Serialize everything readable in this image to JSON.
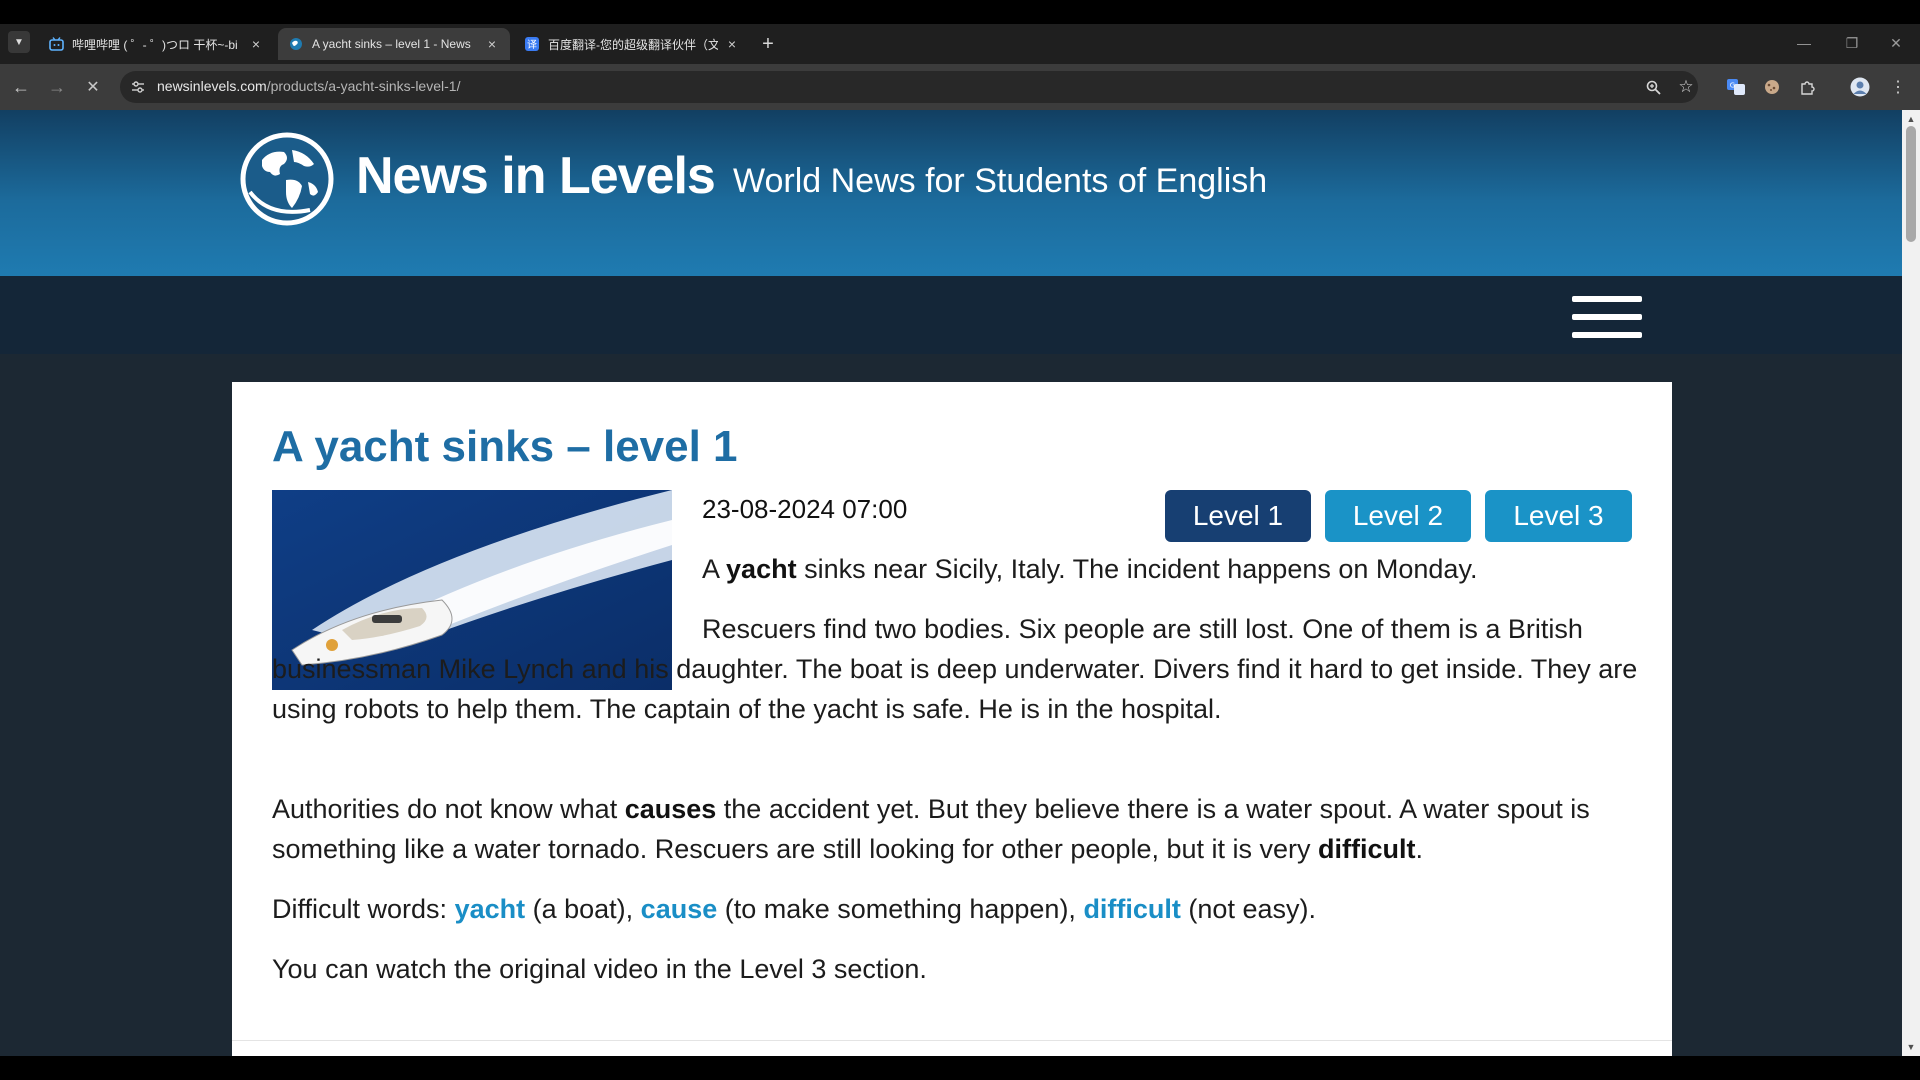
{
  "browser": {
    "tab_list_icon": "chevron-down-icon",
    "tabs": [
      {
        "title": "哔哩哔哩 ( ゜- ゜)つロ 干杯~-bi",
        "favicon": "bilibili-icon",
        "active": false
      },
      {
        "title": "A yacht sinks – level 1 - News",
        "favicon": "newsinlevels-icon",
        "active": true
      },
      {
        "title": "百度翻译-您的超级翻译伙伴（文",
        "favicon": "baidu-translate-icon",
        "active": false
      }
    ],
    "url_host": "newsinlevels.com",
    "url_path": "/products/a-yacht-sinks-level-1/"
  },
  "site": {
    "name": "News in Levels",
    "tagline": "World News for Students of English"
  },
  "article": {
    "title": "A yacht sinks – level 1",
    "date": "23-08-2024 07:00",
    "levels": [
      "Level 1",
      "Level 2",
      "Level 3"
    ],
    "p1": {
      "a": "A ",
      "yacht": "yacht",
      "rest": " sinks near Sicily, Italy. The incident happens on Monday."
    },
    "p2": "Rescuers find two bodies. Six people are still lost. One of them is a British businessman Mike Lynch and his daughter. The boat is deep underwater. Divers find it hard to get inside. They are using robots to help them. The captain of the yacht is safe. He is in the hospital.",
    "p3": {
      "a": "Authorities do not know what ",
      "causes": "causes",
      "b": " the accident yet. But they believe there is a water spout. A water spout is something like a water tornado. Rescuers are still looking for other people, but it is very ",
      "difficult": "difficult",
      "c": "."
    },
    "p4": {
      "lead": "Difficult words: ",
      "w1": "yacht",
      "d1": " (a boat), ",
      "w2": "cause",
      "d2": " (to make something happen), ",
      "w3": "difficult",
      "d3": " (not easy)."
    },
    "p5": "You can watch the original video in the Level 3 section."
  },
  "colors": {
    "title_blue": "#1e6da4",
    "level1_bg": "#173f72",
    "level_bg": "#1a93c7",
    "keyword": "#1a8ec6"
  }
}
